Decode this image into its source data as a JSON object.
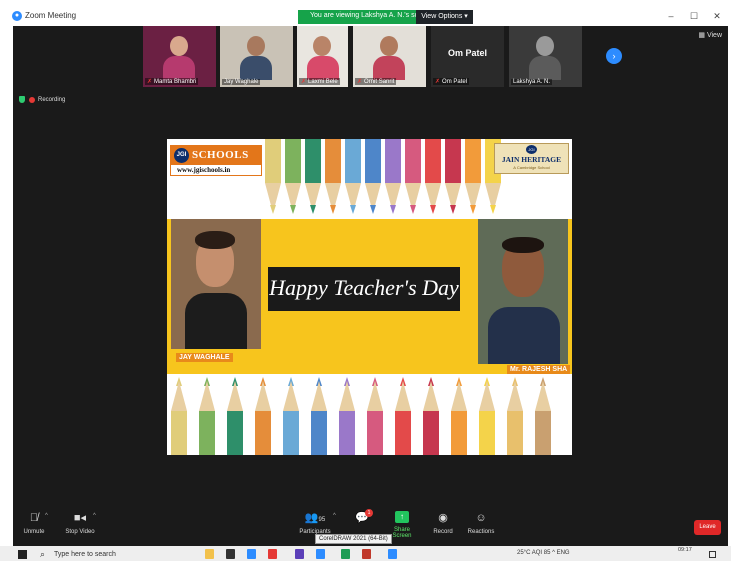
{
  "window": {
    "title": "Zoom Meeting",
    "share_banner": "You are viewing Lakshya A. N.'s screen",
    "view_options": "View Options",
    "view_button": "View",
    "min": "–",
    "max": "☐",
    "close": "✕"
  },
  "gallery": {
    "tiles": [
      {
        "label": "Mamta Bhambri"
      },
      {
        "label": "Jay Waghale"
      },
      {
        "label": "Laxmi Bele"
      },
      {
        "label": "Ornit Sanrit"
      },
      {
        "label": "Om Patel",
        "title": "Om Patel"
      },
      {
        "label": "Lakshya A. N."
      }
    ],
    "next": "›"
  },
  "status": {
    "recording": "Recording"
  },
  "shared_screen": {
    "logo_left": {
      "badge": "JGI",
      "name": "SCHOOLS",
      "url": "www.jgischools.in"
    },
    "logo_right": {
      "badge": "JGI",
      "name": "JAIN HERITAGE",
      "sub": "A Cambridge School"
    },
    "banner": "Happy Teacher's Day",
    "label_left": "JAY WAGHALE",
    "label_right": "Mr. RAJESH SHA",
    "pencil_colors": [
      "#e0cd7a",
      "#7db25d",
      "#2e8f6a",
      "#e58d3a",
      "#6aa9d6",
      "#4e86c9",
      "#9a78c9",
      "#d65a7f",
      "#e34a4a",
      "#c6374f",
      "#f29b3a",
      "#f4d34a",
      "#e8c06c",
      "#c9a070"
    ]
  },
  "toolbar": {
    "unmute": "Unmute",
    "stop_video": "Stop Video",
    "participants": "Participants",
    "participants_count": "95",
    "chat_badge": "1",
    "share_screen": "Share Screen",
    "record": "Record",
    "reactions": "Reactions",
    "tooltip": "CorelDRAW 2021 (64-Bit)",
    "leave": "Leave"
  },
  "taskbar": {
    "search": "Type here to search",
    "tray": "25°C AQI 85  ^  ENG",
    "time": "09:17"
  },
  "colors": {
    "zoom_blue": "#2d8cff",
    "banner_green": "#16a34a",
    "leave_red": "#e02828",
    "meeting_bg": "#1a1a1a",
    "slide_yellow": "#f7c51d"
  }
}
